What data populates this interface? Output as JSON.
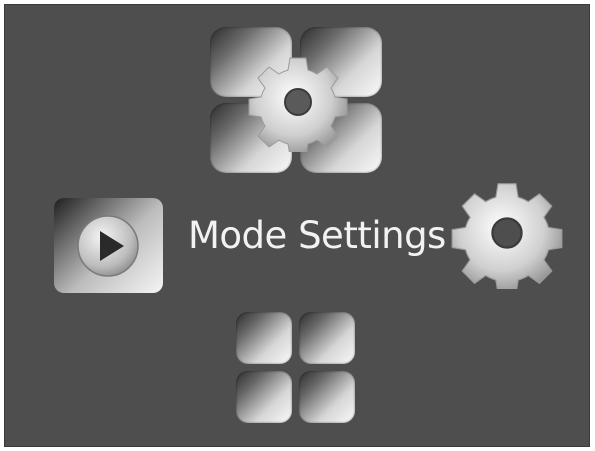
{
  "screen": {
    "title": "Mode Settings"
  },
  "icons": {
    "top": "four-tiles-with-gear-icon",
    "left": "play-icon",
    "right": "gear-icon",
    "bottom": "four-tiles-icon"
  },
  "colors": {
    "background": "#4e4e4e",
    "text": "#f2f2f2"
  }
}
